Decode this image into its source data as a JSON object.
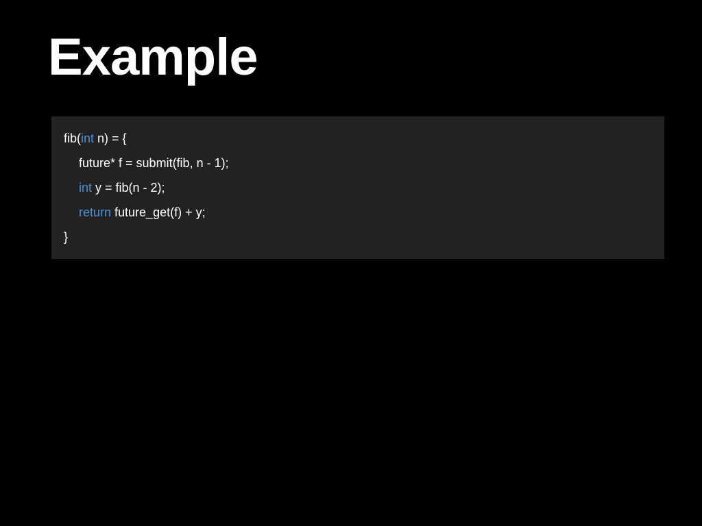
{
  "title": "Example",
  "code": {
    "line1_pre": "fib(",
    "line1_kw": "int",
    "line1_post": " n) = {",
    "line2": "future* f = submit(fib, n - 1);",
    "line3_kw": "int",
    "line3_post": " y = fib(n - 2);",
    "line4_kw": "return",
    "line4_post": " future_get(f) + y;",
    "line5": "}"
  }
}
